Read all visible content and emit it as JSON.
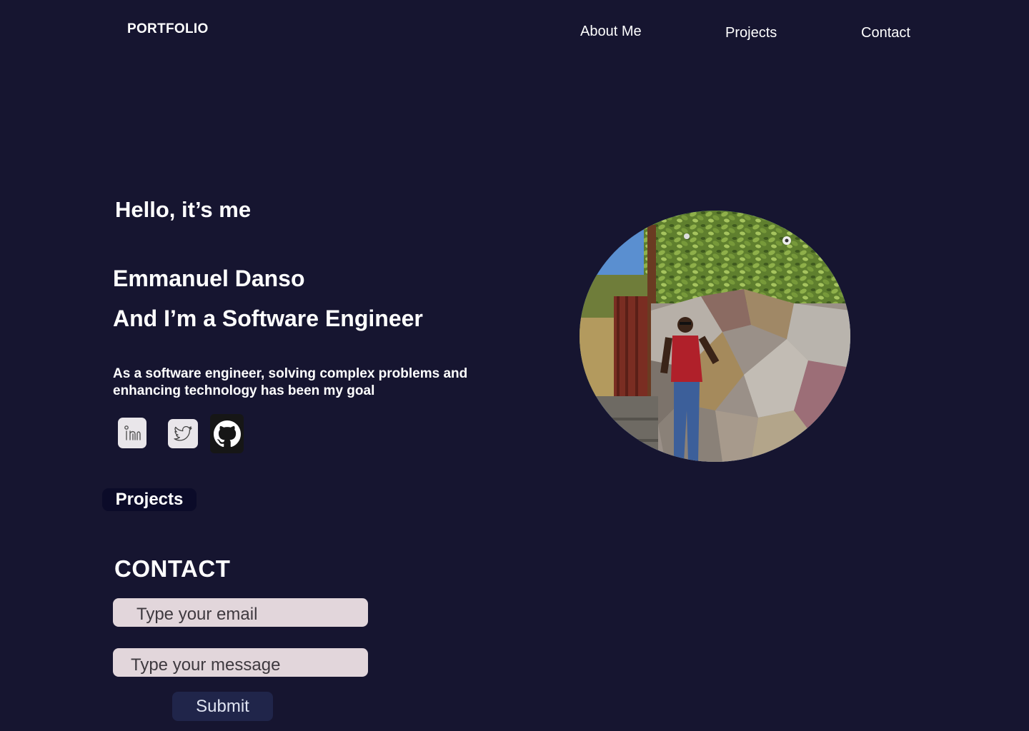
{
  "header": {
    "brand": "PORTFOLIO",
    "nav": [
      "About Me",
      "Projects",
      "Contact"
    ]
  },
  "hero": {
    "greeting": "Hello, it’s me",
    "name": "Emmanuel Danso",
    "role": "And I’m a Software Engineer",
    "tagline": "As a software engineer, solving complex problems and enhancing technology has been my goal"
  },
  "social": {
    "icons": [
      "linkedin-icon",
      "twitter-icon",
      "github-icon"
    ]
  },
  "projects_button": "Projects",
  "contact": {
    "title": "CONTACT",
    "email_placeholder": "Type your email",
    "message_placeholder": "Type your message",
    "submit_label": "Submit"
  },
  "colors": {
    "background": "#161530",
    "input_bg": "#e2d6db",
    "button_bg": "#20254a",
    "projects_button_bg": "#0b0b29"
  }
}
